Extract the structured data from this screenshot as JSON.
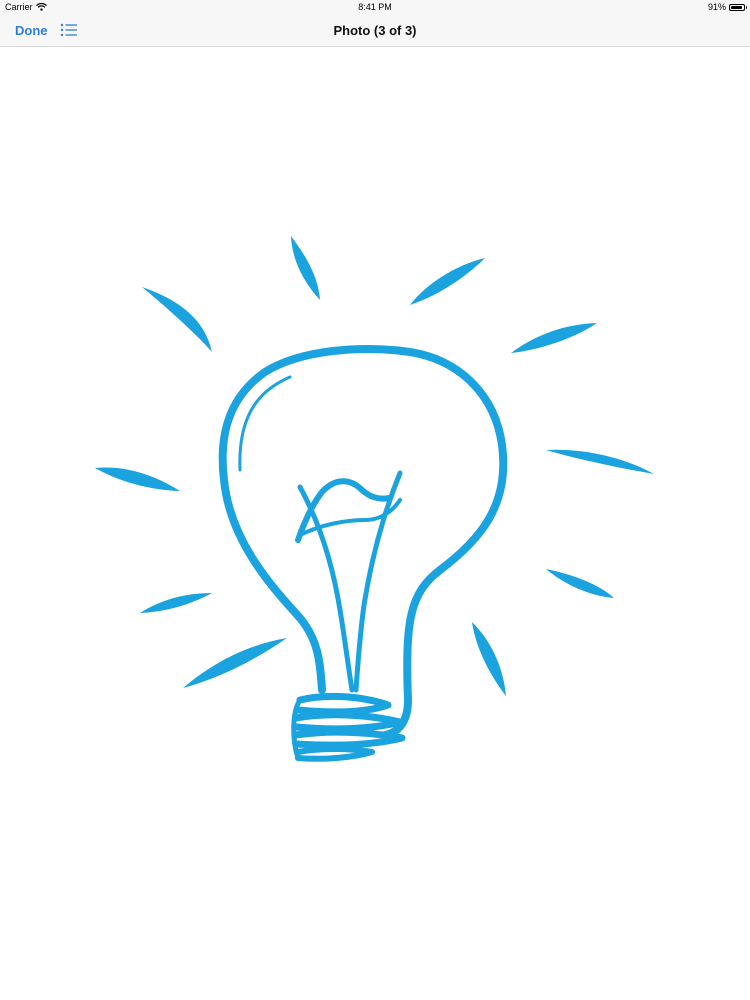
{
  "status_bar": {
    "carrier": "Carrier",
    "time": "8:41 PM",
    "battery_percent": "91%",
    "battery_level": 0.91,
    "wifi_icon": "wifi-icon",
    "battery_icon": "battery-icon"
  },
  "nav_bar": {
    "done_label": "Done",
    "title": "Photo (3 of 3)",
    "list_icon": "list-icon"
  },
  "photo": {
    "subject_icon": "lightbulb-icon",
    "accent_color": "#1ba3e0"
  },
  "colors": {
    "link": "#2b7fd6",
    "bar_background": "#f7f7f7"
  }
}
